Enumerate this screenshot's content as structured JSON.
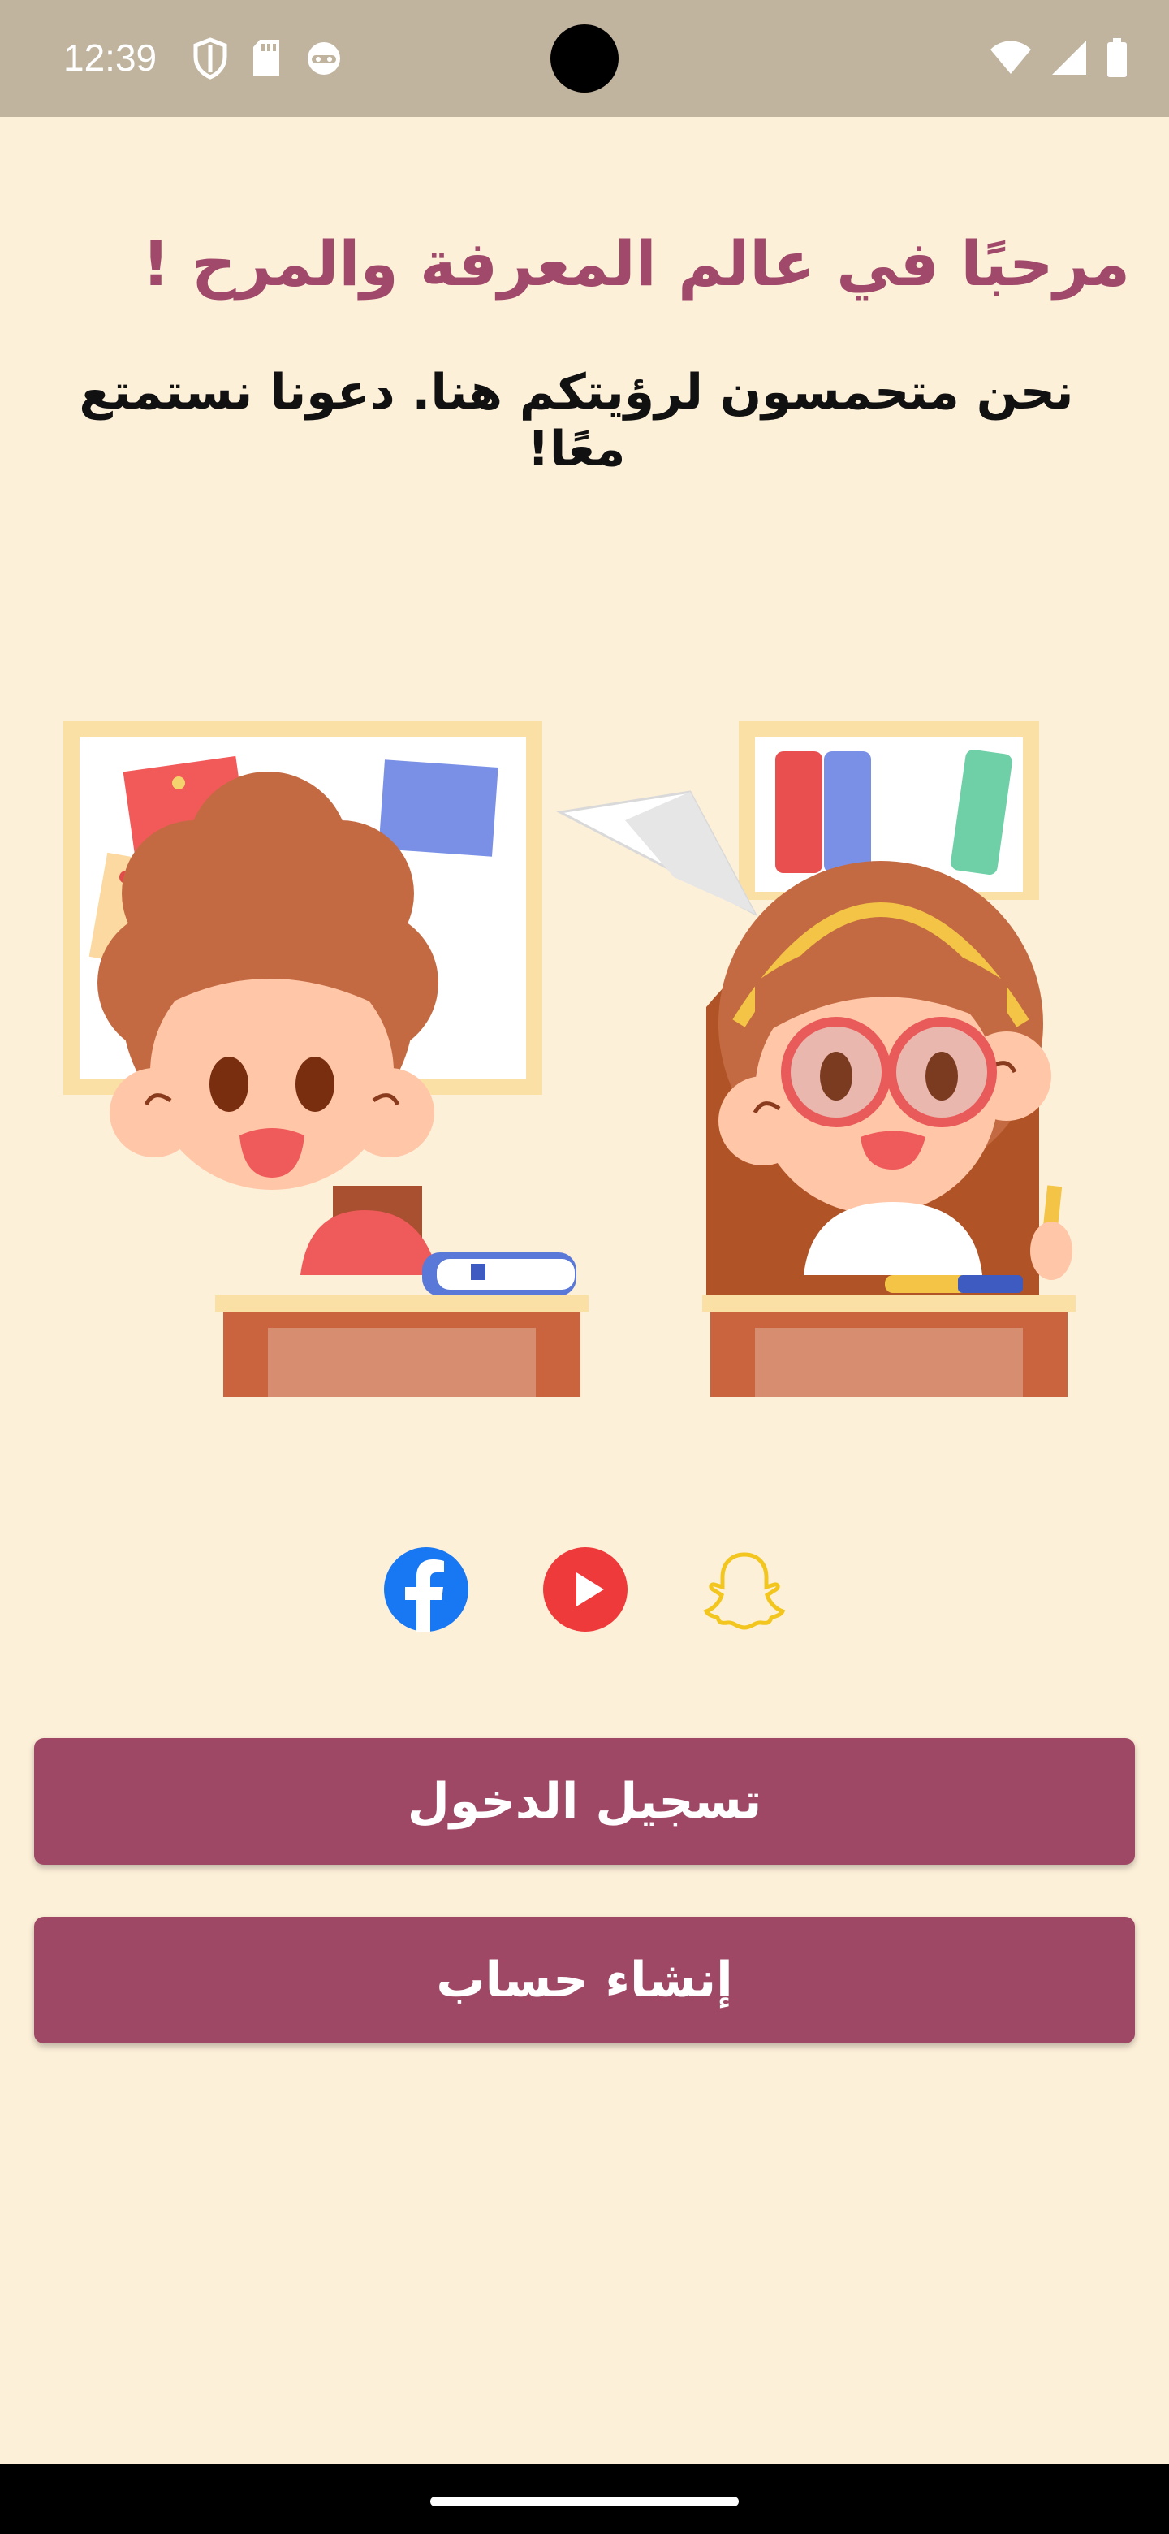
{
  "status_bar": {
    "time": "12:39",
    "left_icons": [
      "shield-icon",
      "sd-card-icon",
      "face-icon"
    ],
    "right_icons": [
      "wifi-icon",
      "cellular-icon",
      "battery-icon"
    ]
  },
  "welcome": {
    "title": "مرحبًا في عالم المعرفة والمرح !",
    "subtitle": "نحن متحمسون لرؤيتكم هنا. دعونا نستمتع معًا!"
  },
  "social": [
    {
      "name": "facebook",
      "icon": "facebook-icon",
      "color": "#1877f2"
    },
    {
      "name": "youtube",
      "icon": "youtube-icon",
      "color": "#ee3a3a"
    },
    {
      "name": "snapchat",
      "icon": "snapchat-icon",
      "color": "#f2c61f"
    }
  ],
  "buttons": {
    "login_label": "تسجيل الدخول",
    "signup_label": "إنشاء حساب"
  },
  "colors": {
    "background": "#fdf0d9",
    "accent": "#9f4866",
    "title": "#a0496a"
  }
}
